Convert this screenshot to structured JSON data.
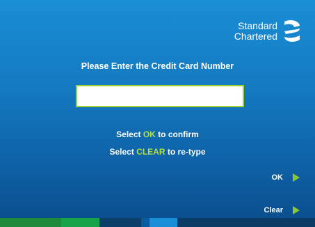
{
  "logo": {
    "line1": "Standard",
    "line2": "Chartered"
  },
  "prompt": "Please Enter the Credit Card Number",
  "card_input": {
    "value": ""
  },
  "instructions": [
    {
      "pre": "Select ",
      "key": "OK",
      "post": " to confirm"
    },
    {
      "pre": "Select ",
      "key": "CLEAR",
      "post": " to re-type"
    }
  ],
  "softkeys": {
    "ok_label": "OK",
    "clear_label": "Clear"
  },
  "colors": {
    "background": "#1479c0",
    "highlight": "#b5e23a",
    "input_border": "#9ad22e",
    "arrow": "#8ac63c",
    "bottom_bar": [
      "#1f8a3c",
      "#17a34a",
      "#0b3f6a",
      "#0a5ca0",
      "#1a8ed6",
      "#0c3c66"
    ]
  },
  "icons": {
    "logo": "standard-chartered-logo-icon",
    "softkey_arrow": "triangle-right-icon"
  }
}
